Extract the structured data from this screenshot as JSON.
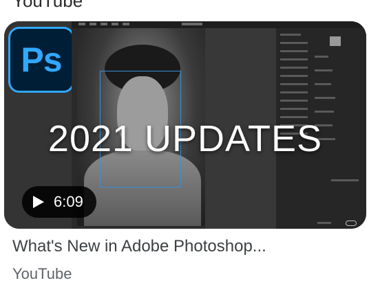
{
  "previous_result": {
    "title_fragment": "YouTube"
  },
  "thumbnail": {
    "logo_text": "Ps",
    "overlay_text": "2021 UPDATES",
    "duration": "6:09",
    "colors": {
      "ps_blue": "#31a8ff",
      "ps_dark": "#001e36",
      "selection": "#3b8fd6"
    },
    "icons": [
      "play-icon"
    ]
  },
  "result": {
    "title": "What's New in Adobe Photoshop...",
    "source": "YouTube"
  }
}
